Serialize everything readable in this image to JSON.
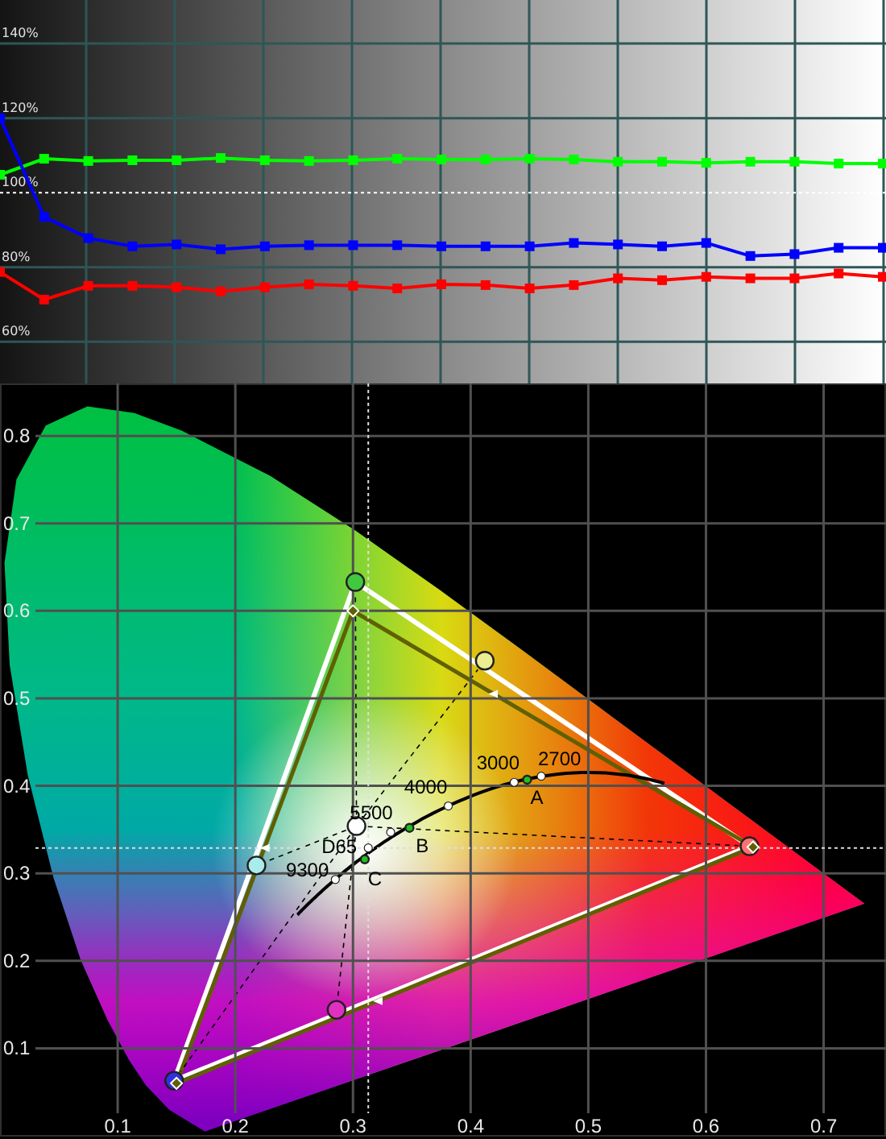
{
  "rgb_balance": {
    "chart_data": {
      "type": "line",
      "ylim": [
        48.8,
        151.7
      ],
      "grid": true,
      "yticks": [
        {
          "value": 140,
          "label": "140%"
        },
        {
          "value": 120,
          "label": "120%"
        },
        {
          "value": 100,
          "label": "100%"
        },
        {
          "value": 80,
          "label": "80%"
        },
        {
          "value": 60,
          "label": "60%"
        }
      ],
      "ref_lines": [
        {
          "axis": "y",
          "value": 100
        }
      ],
      "series": [
        {
          "color": "#00ff00",
          "marker": "square",
          "values": [
            104.8,
            109.1,
            108.5,
            108.7,
            108.7,
            109.3,
            108.7,
            108.5,
            108.7,
            109.1,
            108.9,
            108.9,
            109.1,
            108.9,
            108.3,
            108.3,
            108,
            108.3,
            108.3,
            107.8,
            107.8
          ]
        },
        {
          "color": "#0000ff",
          "marker": "square",
          "values": [
            120,
            93.5,
            87.8,
            85.6,
            86.1,
            84.8,
            85.6,
            85.9,
            85.9,
            85.9,
            85.6,
            85.6,
            85.6,
            86.5,
            86.1,
            85.6,
            86.5,
            83,
            83.5,
            85.2,
            85.2
          ]
        },
        {
          "color": "#ff0000",
          "marker": "square",
          "values": [
            78.7,
            71.3,
            75,
            75,
            74.6,
            73.5,
            74.6,
            75.4,
            75,
            74.3,
            75.4,
            75.2,
            74.3,
            75.2,
            77,
            76.5,
            77.4,
            77,
            77,
            78.3,
            77.4
          ]
        }
      ]
    }
  },
  "gamut": {
    "chart_data": {
      "type": "scatter",
      "grid": true,
      "xlim": [
        0,
        0.753
      ],
      "ylim": [
        0,
        0.86
      ],
      "xticks": [
        0.1,
        0.2,
        0.3,
        0.4,
        0.5,
        0.6,
        0.7
      ],
      "yticks": [
        0.8,
        0.7,
        0.6,
        0.5,
        0.4,
        0.3,
        0.2,
        0.1
      ],
      "ref_lines": [
        {
          "axis": "x",
          "value": 0.313
        },
        {
          "axis": "y",
          "value": 0.329
        }
      ],
      "series": [
        {
          "color": "#606000",
          "marker": "diamond",
          "x": [
            0.64,
            0.3,
            0.15
          ],
          "values": [
            0.33,
            0.6,
            0.06
          ]
        },
        {
          "color": "#ff7070",
          "marker": "circle",
          "x": [
            0.637
          ],
          "values": [
            0.331
          ]
        },
        {
          "color": "#40c840",
          "marker": "circle",
          "x": [
            0.302
          ],
          "values": [
            0.633
          ]
        },
        {
          "color": "#3030e0",
          "marker": "circle",
          "x": [
            0.148
          ],
          "values": [
            0.063
          ]
        },
        {
          "color": "#a8ecec",
          "marker": "circle",
          "x": [
            0.218
          ],
          "values": [
            0.309
          ]
        },
        {
          "color": "#e030c0",
          "marker": "circle",
          "x": [
            0.286
          ],
          "values": [
            0.144
          ]
        },
        {
          "color": "#ecec90",
          "marker": "circle",
          "x": [
            0.412
          ],
          "values": [
            0.543
          ]
        },
        {
          "color": "#ffffff",
          "marker": "circle",
          "x": [
            0.303
          ],
          "values": [
            0.354
          ]
        },
        {
          "color": "#ffffff",
          "marker": "triangle",
          "x": [
            0.225,
            0.321,
            0.419
          ],
          "values": [
            0.329,
            0.154,
            0.505
          ]
        },
        {
          "color": "#ffffff",
          "marker": "circle",
          "x": [
            0.332,
            0.313,
            0.285,
            0.381,
            0.437,
            0.46
          ],
          "values": [
            0.347,
            0.329,
            0.293,
            0.377,
            0.404,
            0.411
          ]
        },
        {
          "color": "#20c020",
          "marker": "circle",
          "x": [
            0.448,
            0.348,
            0.31
          ],
          "values": [
            0.407,
            0.352,
            0.316
          ]
        }
      ],
      "annotations": [
        "5500",
        "D65",
        "9300",
        "4000",
        "3000",
        "2700",
        "A",
        "B",
        "C"
      ]
    }
  }
}
